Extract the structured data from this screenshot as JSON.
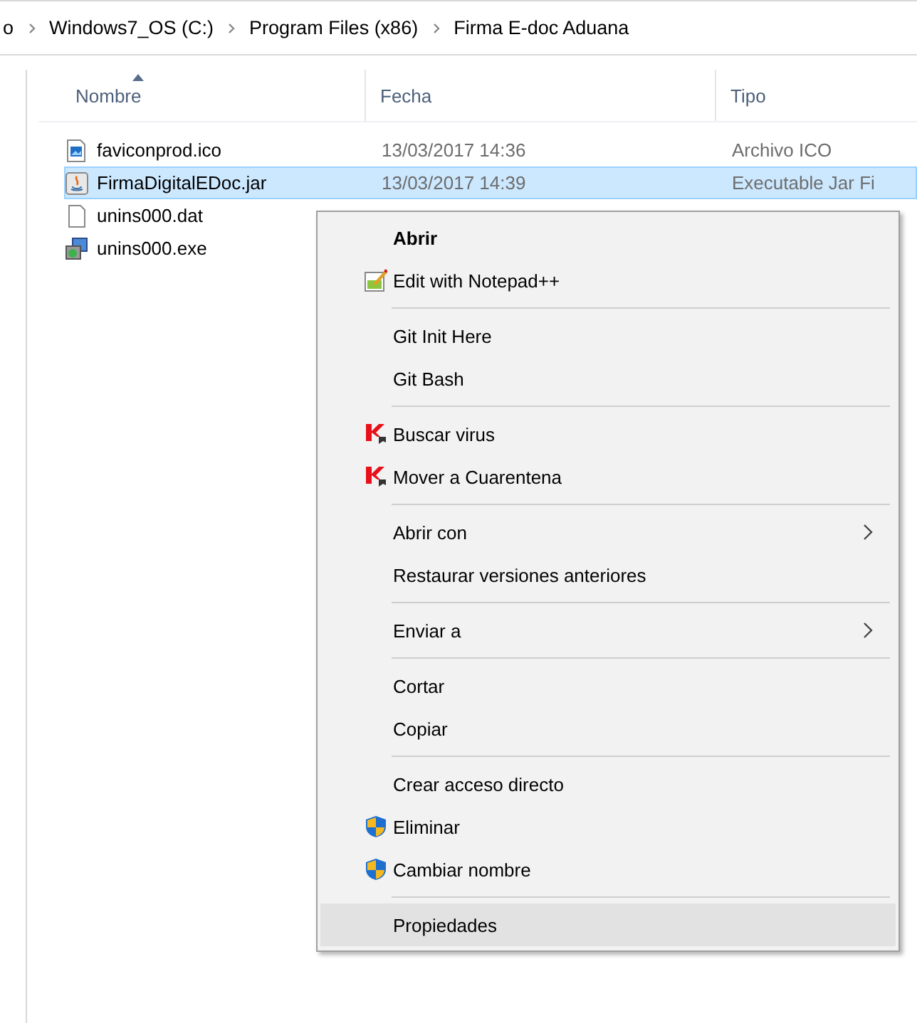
{
  "breadcrumb": [
    "o",
    "Windows7_OS (C:)",
    "Program Files (x86)",
    "Firma E-doc Aduana"
  ],
  "columns": [
    {
      "label": "Nombre",
      "sorted": true
    },
    {
      "label": "Fecha",
      "sorted": false
    },
    {
      "label": "Tipo",
      "sorted": false
    }
  ],
  "files": [
    {
      "kind": "image",
      "name": "faviconprod.ico",
      "date": "13/03/2017 14:36",
      "type": "Archivo ICO",
      "selected": false
    },
    {
      "kind": "java",
      "name": "FirmaDigitalEDoc.jar",
      "date": "13/03/2017 14:39",
      "type": "Executable Jar Fi",
      "selected": true
    },
    {
      "kind": "blank",
      "name": "unins000.dat",
      "selected": false
    },
    {
      "kind": "installer",
      "name": "unins000.exe",
      "selected": false
    }
  ],
  "context_menu": [
    {
      "kind": "item",
      "label": "Abrir",
      "default": true,
      "selected": false
    },
    {
      "kind": "notepad",
      "label": "Edit with Notepad++",
      "selected": false
    },
    {
      "kind": "separator"
    },
    {
      "kind": "item",
      "label": "Git Init Here",
      "selected": false
    },
    {
      "kind": "item",
      "label": "Git Bash",
      "selected": false
    },
    {
      "kind": "separator"
    },
    {
      "kind": "antivirus",
      "label": "Buscar virus",
      "selected": false
    },
    {
      "kind": "antivirus",
      "label": "Mover a Cuarentena",
      "selected": false
    },
    {
      "kind": "separator"
    },
    {
      "kind": "item",
      "label": "Abrir con",
      "submenu": true,
      "selected": false
    },
    {
      "kind": "item",
      "label": "Restaurar versiones anteriores",
      "selected": false
    },
    {
      "kind": "separator"
    },
    {
      "kind": "item",
      "label": "Enviar a",
      "submenu": true,
      "selected": false
    },
    {
      "kind": "separator"
    },
    {
      "kind": "item",
      "label": "Cortar",
      "selected": false
    },
    {
      "kind": "item",
      "label": "Copiar",
      "selected": false
    },
    {
      "kind": "separator"
    },
    {
      "kind": "item",
      "label": "Crear acceso directo",
      "selected": false
    },
    {
      "kind": "shield",
      "label": "Eliminar",
      "selected": false
    },
    {
      "kind": "shield",
      "label": "Cambiar nombre",
      "selected": false
    },
    {
      "kind": "separator"
    },
    {
      "kind": "item",
      "label": "Propiedades",
      "selected": true
    }
  ]
}
